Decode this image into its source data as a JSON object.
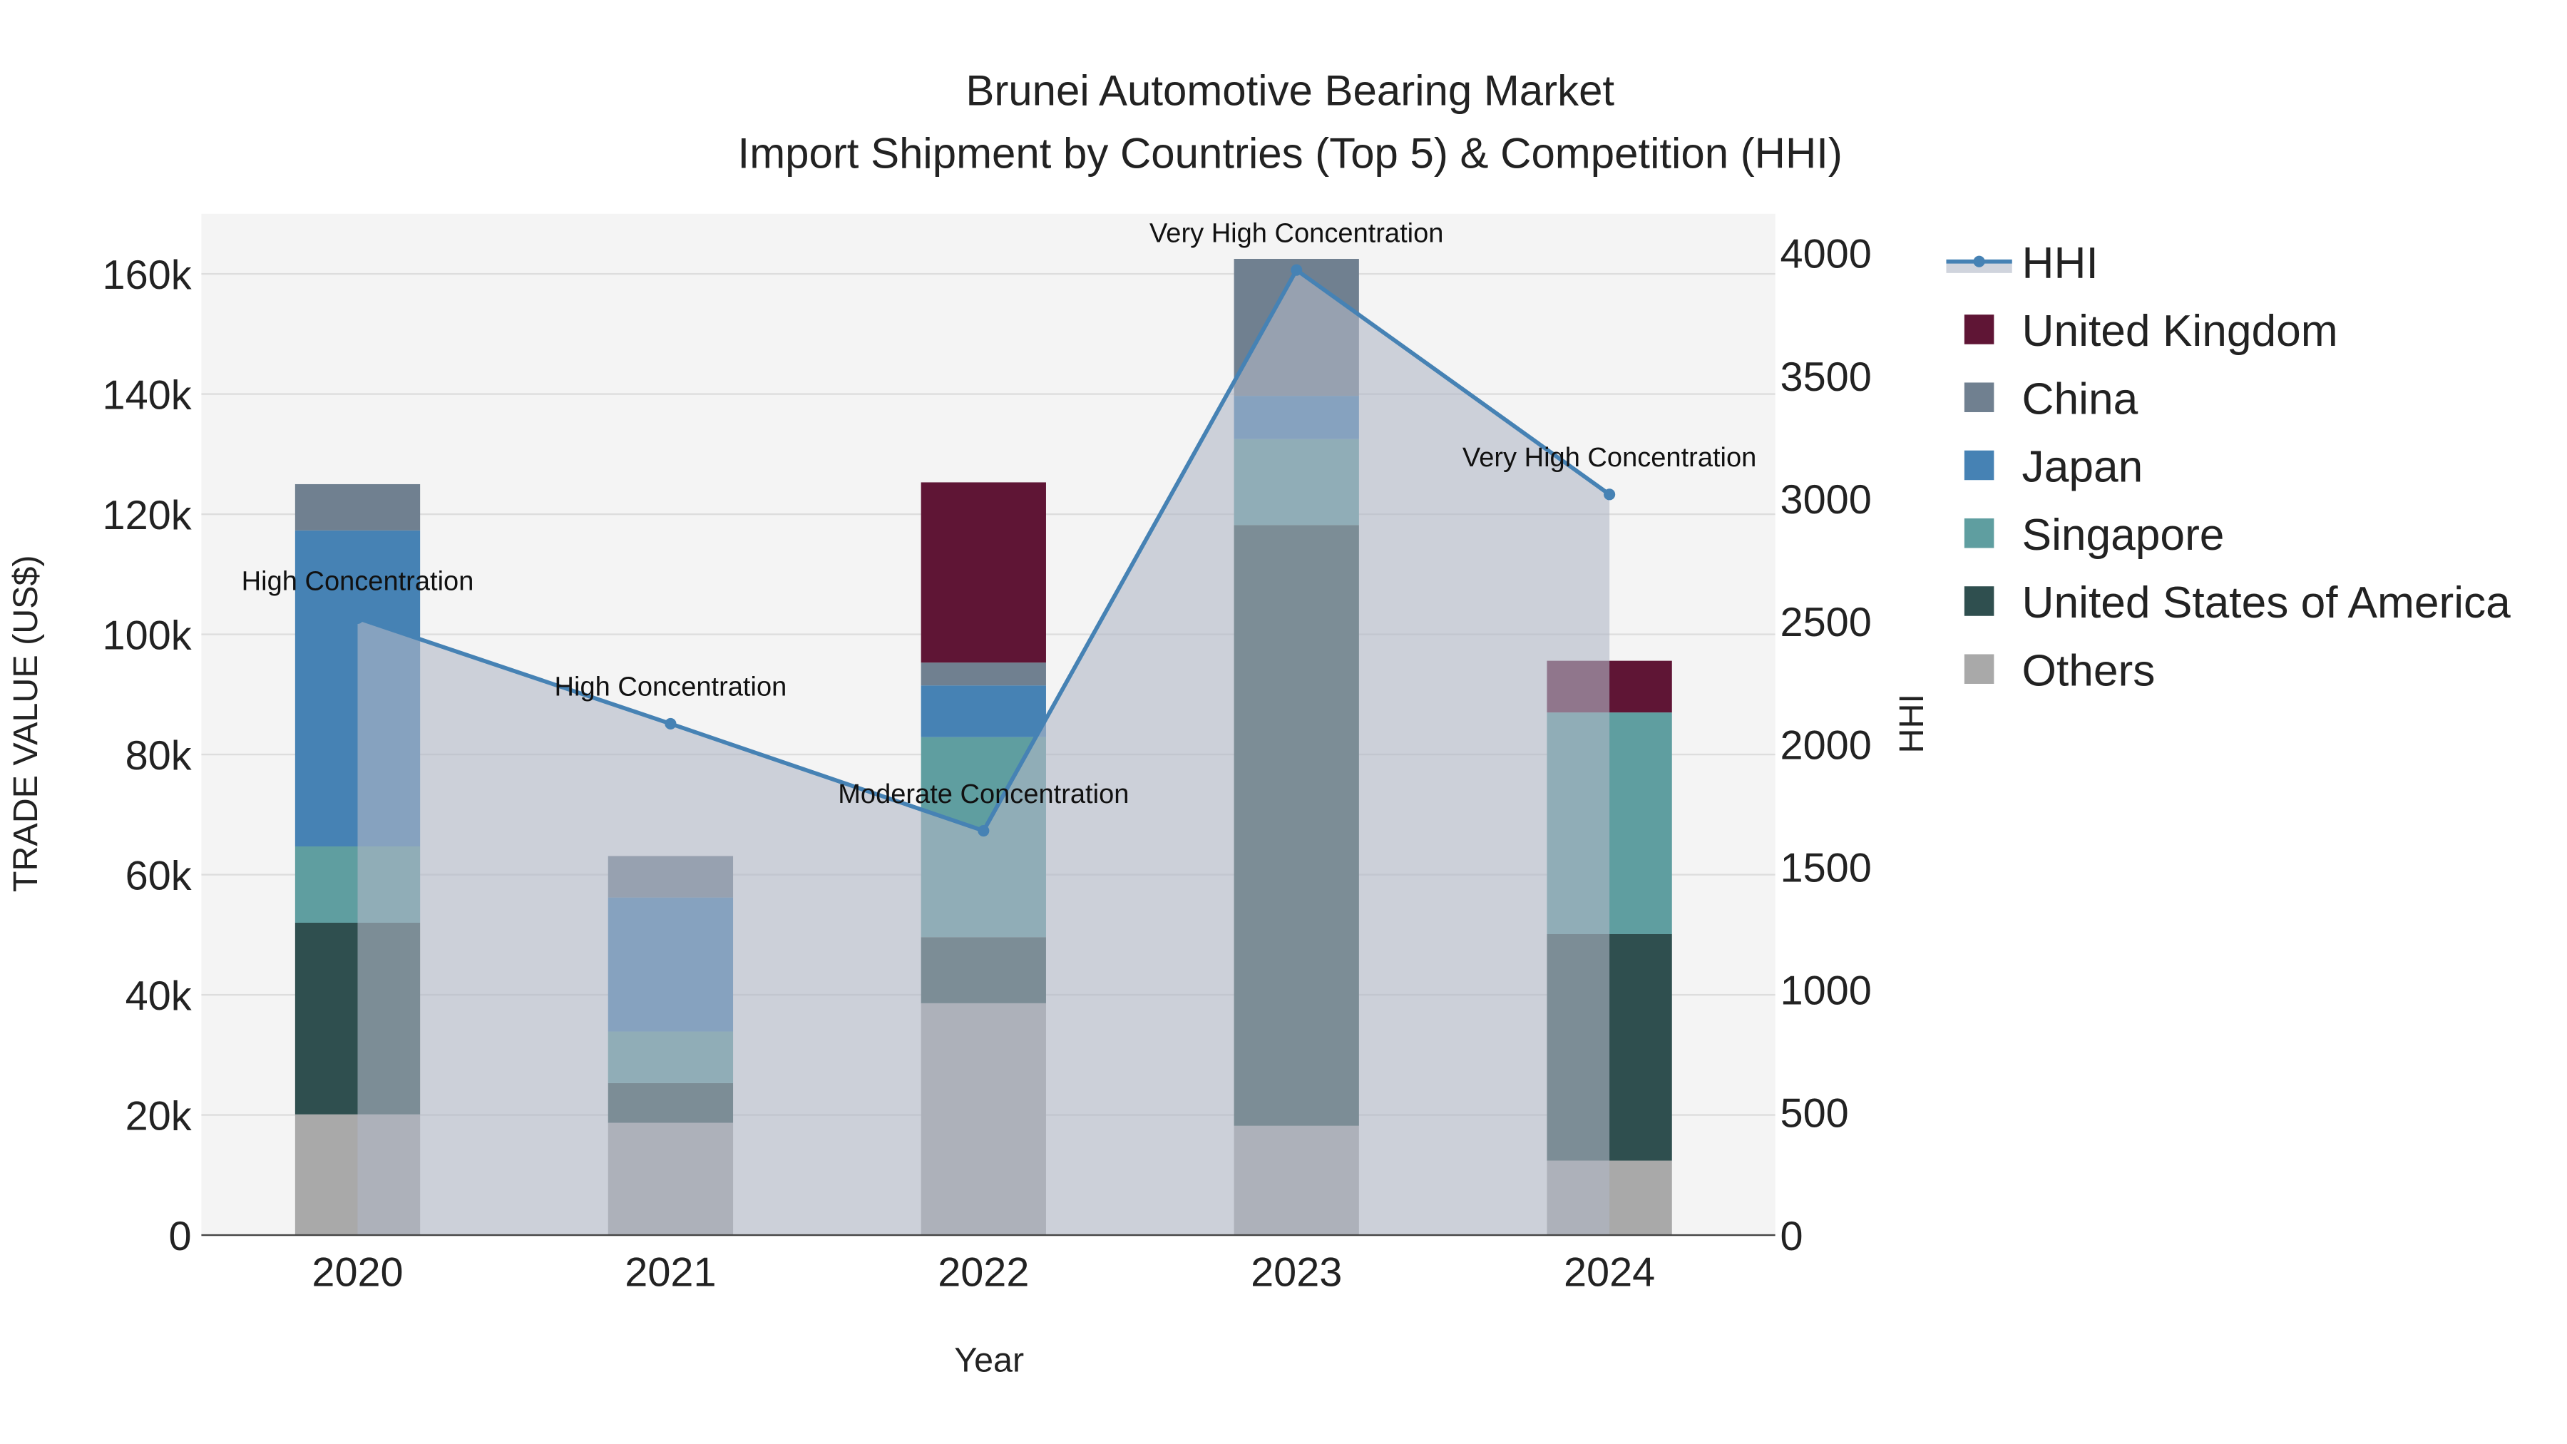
{
  "chart_data": {
    "type": "bar",
    "title": "Brunei Automotive Bearing Market",
    "subtitle": "Import Shipment by Countries (Top 5) & Competition (HHI)",
    "xlabel": "Year",
    "ylabel": "TRADE VALUE (US$)",
    "y2label": "HHI",
    "categories": [
      "2020",
      "2021",
      "2022",
      "2023",
      "2024"
    ],
    "ylim": [
      0,
      170000
    ],
    "y2lim": [
      0,
      4160
    ],
    "yticks": [
      0,
      20000,
      40000,
      60000,
      80000,
      100000,
      120000,
      140000,
      160000
    ],
    "ytick_labels": [
      "0",
      "20k",
      "40k",
      "60k",
      "80k",
      "100k",
      "120k",
      "140k",
      "160k"
    ],
    "y2ticks": [
      0,
      500,
      1000,
      1500,
      2000,
      2500,
      3000,
      3500,
      4000
    ],
    "y2tick_labels": [
      "0",
      "500",
      "1000",
      "1500",
      "2000",
      "2500",
      "3000",
      "3500",
      "4000"
    ],
    "grid": true,
    "stacked": true,
    "legend_position": "right",
    "series": [
      {
        "name": "Others",
        "color": "#a9a9a9",
        "values": [
          20100,
          18700,
          38600,
          18200,
          12400
        ]
      },
      {
        "name": "United States of America",
        "color": "#2f4f4f",
        "values": [
          31900,
          6600,
          11000,
          100000,
          37700
        ]
      },
      {
        "name": "Singapore",
        "color": "#5f9ea0",
        "values": [
          12700,
          8600,
          33300,
          14300,
          36900
        ]
      },
      {
        "name": "Japan",
        "color": "#4682b4",
        "values": [
          52600,
          22300,
          8600,
          7200,
          0
        ]
      },
      {
        "name": "China",
        "color": "#708090",
        "values": [
          7700,
          6900,
          3800,
          22800,
          0
        ]
      },
      {
        "name": "United Kingdom",
        "color": "#5f1535",
        "values": [
          0,
          0,
          30000,
          0,
          8600
        ]
      }
    ],
    "line": {
      "name": "HHI",
      "color": "#4682b4",
      "values": [
        2513,
        2083,
        1647,
        3931,
        3017
      ]
    },
    "annotations": [
      "High Concentration",
      "High Concentration",
      "Moderate Concentration",
      "Very High Concentration",
      "Very High Concentration"
    ],
    "legend": [
      "HHI",
      "United Kingdom",
      "China",
      "Japan",
      "Singapore",
      "United States of America",
      "Others"
    ]
  }
}
